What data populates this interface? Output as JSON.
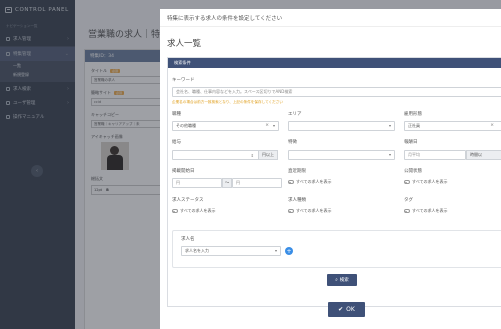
{
  "sidebar": {
    "brand": "CONTROL PANEL",
    "subtitle": "ナビゲーション一覧",
    "items": [
      {
        "label": "求人管理"
      },
      {
        "label": "特集管理"
      },
      {
        "label": "求人検索"
      },
      {
        "label": "ユーザ管理"
      },
      {
        "label": "操作マニュアル"
      }
    ],
    "subitems": [
      {
        "label": "一覧"
      },
      {
        "label": "新規登録"
      }
    ]
  },
  "background": {
    "page_title": "営業職の求人｜特集",
    "card_title": "特集ID：34",
    "title_label": "タイトル",
    "required_tag": "必須",
    "title_value": "営業職の求人",
    "url_label": "簡略サイト",
    "url_value": "ccid",
    "catch_label": "キャッチコピー",
    "catch_value": "営業職｜キャリアアップ｜未",
    "eyecatch_label": "アイキャッチ画像",
    "summary_label": "総括文",
    "toolbar_size": "12pt",
    "toolbar_bold": "B"
  },
  "modal": {
    "header_text": "特集に表示する求人の条件を設定してください",
    "title": "求人一覧",
    "panel_title": "検索条件",
    "keyword_label": "キーワード",
    "keyword_placeholder": "会社名、職種、仕事内容などを入力。スペース区切りでAND検索",
    "keyword_warning": "企業名の場合は前方一致検索となり、上記の条件を保存してください",
    "fields": {
      "job_type_label": "職種",
      "job_type_value": "その他職種",
      "area_label": "エリア",
      "employment_label": "雇用形態",
      "employment_value": "正社員",
      "salary_label": "給与",
      "salary_suffix": "円以上",
      "feature_label": "特徴",
      "reward_label": "報酬日",
      "reward_placeholder": "月平均",
      "reward_suffix": "時間以",
      "posted_label": "掲載開始日",
      "date_from": "円",
      "date_to": "円",
      "tilde": "〜",
      "recent_label": "直近期限",
      "recent_toggle": "すべての求人を表示",
      "public_label": "公開状態",
      "public_toggle": "すべての求人を表示",
      "status_label": "求人ステータス",
      "status_toggle": "すべての求人を表示",
      "kind_label": "求人種類",
      "kind_toggle": "すべての求人を表示",
      "tag_label": "タグ",
      "tag_toggle": "すべての求人を表示"
    },
    "job_name_label": "求人名",
    "job_name_placeholder": "求人名を入力",
    "search_button": "検索",
    "ok_button": "OK"
  },
  "colors": {
    "sidebar_bg": "#3a4351",
    "accent_navy": "#3f5178",
    "warning": "#e0a020",
    "plus_blue": "#3a8ee6"
  }
}
